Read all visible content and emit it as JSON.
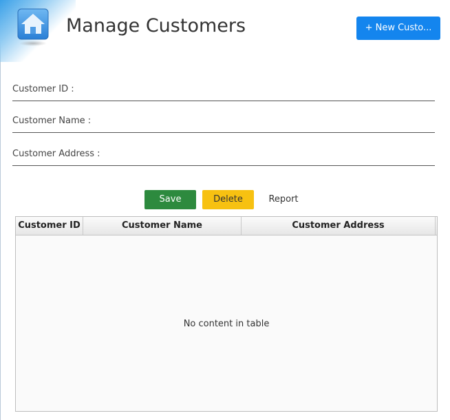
{
  "header": {
    "title": "Manage Customers",
    "new_button_label": "+ New Custo...",
    "home_icon": "home-icon"
  },
  "form": {
    "fields": [
      {
        "label": "Customer ID :",
        "value": ""
      },
      {
        "label": "Customer Name :",
        "value": ""
      },
      {
        "label": "Customer Address :",
        "value": ""
      }
    ]
  },
  "actions": {
    "save_label": "Save",
    "delete_label": "Delete",
    "report_label": "Report"
  },
  "table": {
    "columns": [
      "Customer ID",
      "Customer Name",
      "Customer Address"
    ],
    "rows": [],
    "empty_message": "No content in table"
  },
  "colors": {
    "primary_button": "#1485ee",
    "save_button": "#2d8a3e",
    "delete_button": "#f7c111"
  }
}
